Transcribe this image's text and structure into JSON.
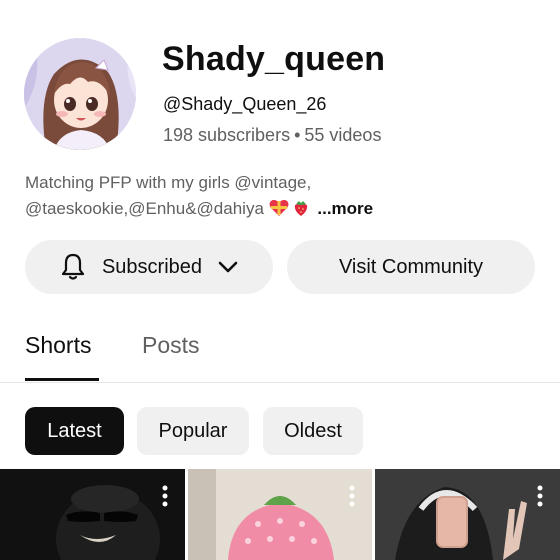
{
  "channel": {
    "name": "Shady_queen",
    "handle": "@Shady_Queen_26",
    "subscribers": "198 subscribers",
    "separator": "•",
    "videos": "55 videos",
    "description_line1": "Matching PFP with my girls @vintage,",
    "description_line2": "@taeskookie,@Enhu&@dahiya",
    "more": "...more"
  },
  "actions": {
    "subscribe_label": "Subscribed",
    "community_label": "Visit Community"
  },
  "tabs": [
    {
      "label": "Shorts",
      "active": true
    },
    {
      "label": "Posts",
      "active": false
    }
  ],
  "filters": [
    {
      "label": "Latest",
      "selected": true
    },
    {
      "label": "Popular",
      "selected": false
    },
    {
      "label": "Oldest",
      "selected": false
    }
  ],
  "icons": {
    "bell": "bell-icon",
    "chevron": "chevron-down-icon",
    "more": "more-vert-icon"
  },
  "colors": {
    "text_primary": "#0f0f0f",
    "text_secondary": "#606060",
    "button_bg": "#f0f0f0",
    "chip_selected_bg": "#0f0f0f"
  }
}
